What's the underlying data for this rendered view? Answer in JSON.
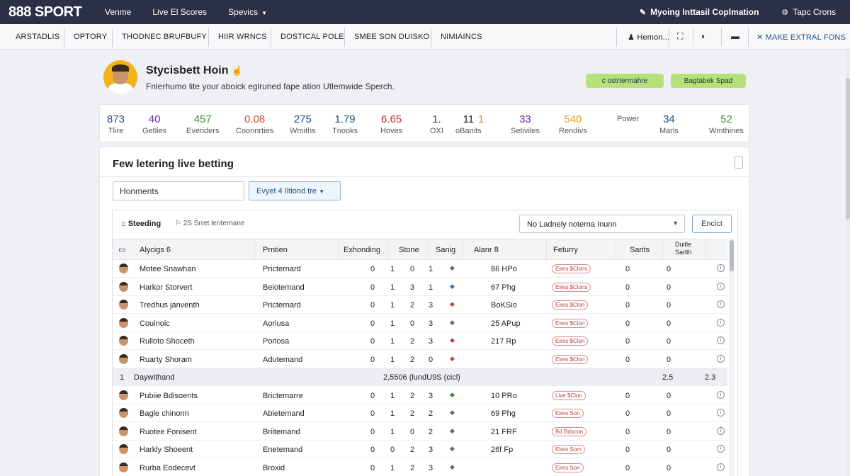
{
  "topbar": {
    "logo": "888 SPORT",
    "nav": [
      "Venme",
      "Live El Scores",
      "Spevics"
    ],
    "right_primary": "Myoing Inttasil Coplmation",
    "right_secondary": "Tapc Crons"
  },
  "subnav": {
    "items": [
      "ARSTADLIS",
      "OPTORY",
      "THODNEC BRUFBUFY",
      "HIIR WRNCS",
      "DOSTICAL POLE",
      "SMEE SON DUISKO",
      "NIMIAINCS"
    ],
    "right_item": "Hemon...",
    "right_link": "MAKE EXTRAL FONS"
  },
  "profile": {
    "name": "Stycisbett Hoin",
    "subtitle": "Fnlerhumo lite your aboick eglruned fape ation Utlemwide Sperch.",
    "button_a": "c ostrtermahre",
    "button_b": "Bagtabek Spad"
  },
  "stats": [
    {
      "value": "873",
      "label": "Tlire",
      "color": "#1d4f8a"
    },
    {
      "value": "40",
      "label": "Getlies",
      "color": "#6a2ca0"
    },
    {
      "value": "457",
      "label": "Everiders",
      "color": "#3b8a2a"
    },
    {
      "value": "0.08",
      "label": "Coonnrties",
      "color": "#d64a2a"
    },
    {
      "value": "275",
      "label": "Wmiths",
      "color": "#1d4f8a"
    },
    {
      "value": "1.79",
      "label": "Tnooks",
      "color": "#1d4f8a"
    },
    {
      "value": "6.65",
      "label": "Hoves",
      "color": "#c03030"
    },
    {
      "value": "1.",
      "label": "OXI",
      "color": "#1d4f8a"
    },
    {
      "value": "11",
      "label": "oBanits",
      "color": "#222"
    },
    {
      "value": "1",
      "label": "",
      "color": "#e08a1a"
    },
    {
      "value": "33",
      "label": "Setiviles",
      "color": "#6a2ca0"
    },
    {
      "value": "540",
      "label": "Rendivs",
      "color": "#e0a01a"
    },
    {
      "value": "",
      "label": "Power",
      "color": "#1d4f8a"
    },
    {
      "value": "34",
      "label": "Marls",
      "color": "#1d4f8a"
    },
    {
      "value": "52",
      "label": "Wmthines",
      "color": "#3b8a2a"
    }
  ],
  "main": {
    "title": "Few letering live betting",
    "search_value": "Honments",
    "event_dropdown": "Evyet  4 Iltiond tre",
    "panel_label": "Steeding",
    "panel_sub": "2S Srret lenternane",
    "select_value": "No Ladnely noterna Inunn",
    "action_button": "Encict"
  },
  "table": {
    "headers": [
      "Alycigs 6",
      "Prntien",
      "Exhonding",
      "Stone",
      "Sanig",
      "Alanr 8",
      "Feturry",
      "Sarits",
      "Duitle Sarlth"
    ],
    "rows": [
      {
        "name": "Motee Snawhan",
        "pos": "Pricternard",
        "a": "0",
        "b": "1",
        "c": "0",
        "d": "1",
        "odds": "86 HPo",
        "tag": "Eires  $Clons",
        "s1": "0",
        "s2": "0"
      },
      {
        "name": "Harkor Storvert",
        "pos": "Beiotemand",
        "a": "0",
        "b": "1",
        "c": "3",
        "d": "1",
        "odds": "67 Phg",
        "tag": "Eires  $Clons",
        "s1": "0",
        "s2": "0"
      },
      {
        "name": "Tredhus janventh",
        "pos": "Pricternard",
        "a": "0",
        "b": "1",
        "c": "2",
        "d": "3",
        "odds": "BoKSio",
        "tag": "Eires  $Clon",
        "s1": "0",
        "s2": "0"
      },
      {
        "name": "Couinoic",
        "pos": "Aoriusa",
        "a": "0",
        "b": "1",
        "c": "0",
        "d": "3",
        "odds": "25 APup",
        "tag": "Eires  $Clon",
        "s1": "0",
        "s2": "0"
      },
      {
        "name": "Rulloto Shoceth",
        "pos": "Porlosa",
        "a": "0",
        "b": "1",
        "c": "2",
        "d": "3",
        "odds": "217 Rp",
        "tag": "Eires  $Clon",
        "s1": "0",
        "s2": "0"
      },
      {
        "name": "Ruarty Shoram",
        "pos": "Adutemand",
        "a": "0",
        "b": "1",
        "c": "2",
        "d": "0",
        "odds": "",
        "tag": "Eires  $Clon",
        "s1": "0",
        "s2": "0"
      }
    ],
    "group": {
      "index": "1",
      "label": "Daywithand",
      "summary": "2,5506 (lundU9S (cicl)",
      "v1": "2.5",
      "v2": "2.3"
    },
    "rows2": [
      {
        "name": "Pubiie Bdisoents",
        "pos": "Brictemarre",
        "a": "0",
        "b": "1",
        "c": "2",
        "d": "3",
        "odds": "10 PRo",
        "tag": "Live  $Clon",
        "s1": "0",
        "s2": "0"
      },
      {
        "name": "Bagle chinonn",
        "pos": "Abietemand",
        "a": "0",
        "b": "1",
        "c": "2",
        "d": "2",
        "odds": "69 Phg",
        "tag": "Eires  Son",
        "s1": "0",
        "s2": "0"
      },
      {
        "name": "Ruotee Fonisent",
        "pos": "Briitemand",
        "a": "0",
        "b": "1",
        "c": "0",
        "d": "2",
        "odds": "21 FRF",
        "tag": "Bd Bdocon",
        "s1": "0",
        "s2": "0"
      },
      {
        "name": "Harkly Shoeent",
        "pos": "Enetemand",
        "a": "0",
        "b": "0",
        "c": "2",
        "d": "3",
        "odds": "26f Fp",
        "tag": "Eires  Som",
        "s1": "0",
        "s2": "0"
      },
      {
        "name": "Rurba Eodecevt",
        "pos": "Broxid",
        "a": "0",
        "b": "1",
        "c": "2",
        "d": "3",
        "odds": "",
        "tag": "Eires  Son",
        "s1": "0",
        "s2": "0"
      }
    ]
  }
}
